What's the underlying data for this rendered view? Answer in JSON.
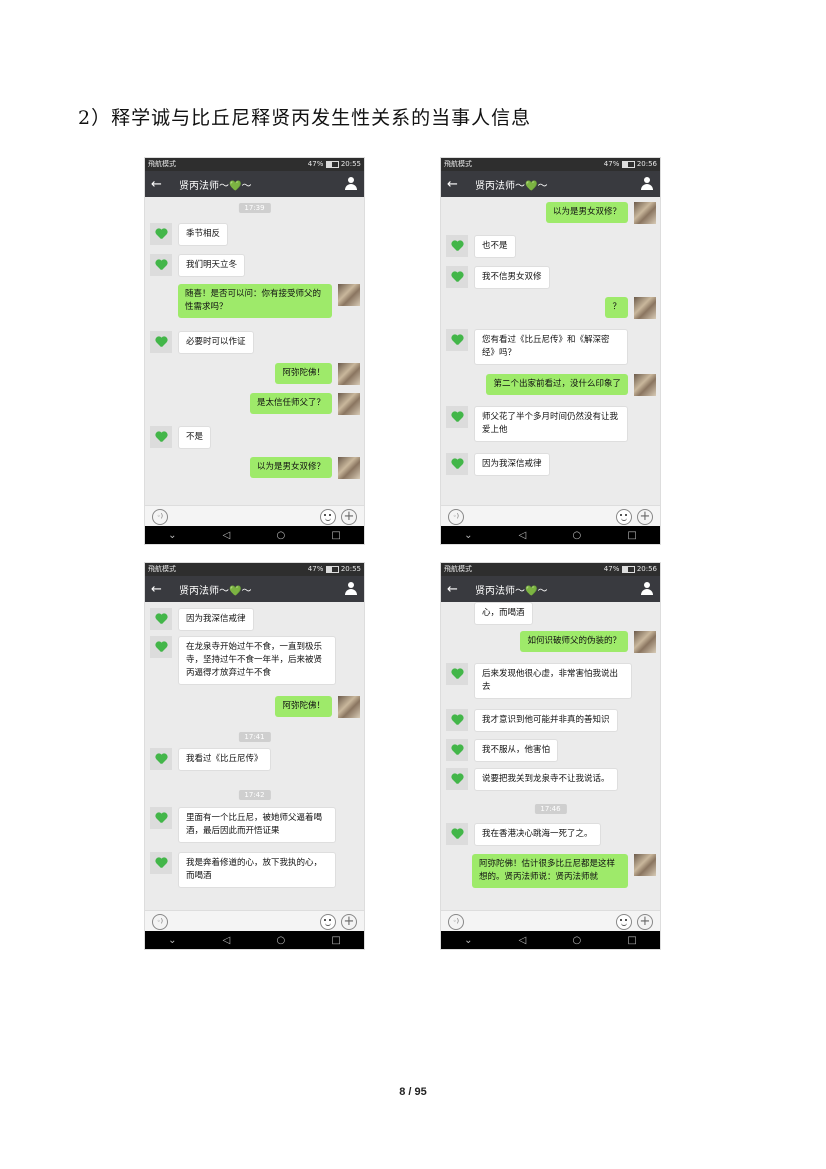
{
  "heading": "2）释学诚与比丘尼释贤丙发生性关系的当事人信息",
  "footer": "8 / 95",
  "status": {
    "left": "飛航模式",
    "right": "47%",
    "time1": "20:55",
    "time2": "20:56"
  },
  "chat_title": "贤丙法师～💚～",
  "screens": [
    {
      "time": "20:55",
      "messages": [
        {
          "dir": "time",
          "text": "17:39"
        },
        {
          "dir": "in",
          "text": "季节相反"
        },
        {
          "dir": "in",
          "text": "我们明天立冬"
        },
        {
          "dir": "out",
          "text": "随喜！是否可以问：你有接受师父的性需求吗？"
        },
        {
          "dir": "in",
          "text": "必要时可以作证"
        },
        {
          "dir": "out",
          "text": "阿弥陀佛！"
        },
        {
          "dir": "out",
          "text": "是太信任师父了？"
        },
        {
          "dir": "in",
          "text": "不是"
        },
        {
          "dir": "out",
          "text": "以为是男女双修？"
        }
      ]
    },
    {
      "time": "20:56",
      "messages": [
        {
          "dir": "out",
          "text": "以为是男女双修？"
        },
        {
          "dir": "in",
          "text": "也不是"
        },
        {
          "dir": "in",
          "text": "我不信男女双修"
        },
        {
          "dir": "out",
          "text": "？"
        },
        {
          "dir": "in",
          "text": "您有看过《比丘尼传》和《解深密经》吗？"
        },
        {
          "dir": "out",
          "text": "第二个出家前看过，没什么印象了"
        },
        {
          "dir": "in",
          "text": "师父花了半个多月时间仍然没有让我爱上他"
        },
        {
          "dir": "in",
          "text": "因为我深信戒律"
        }
      ]
    },
    {
      "time": "20:55",
      "messages": [
        {
          "dir": "in",
          "text": "因为我深信戒律"
        },
        {
          "dir": "in",
          "text": "在龙泉寺开始过午不食，一直到极乐寺，坚持过午不食一年半，后来被贤丙逼得才放弃过午不食"
        },
        {
          "dir": "out",
          "text": "阿弥陀佛！"
        },
        {
          "dir": "time",
          "text": "17:41"
        },
        {
          "dir": "in",
          "text": "我看过《比丘尼传》"
        },
        {
          "dir": "time",
          "text": "17:42"
        },
        {
          "dir": "in",
          "text": "里面有一个比丘尼，被她师父逼着喝酒，最后因此而开悟证果"
        },
        {
          "dir": "in",
          "text": "我是奔着修道的心，放下我执的心，而喝酒"
        }
      ]
    },
    {
      "time": "20:56",
      "messages": [
        {
          "dir": "in",
          "text": "心，而喝酒"
        },
        {
          "dir": "out",
          "text": "如何识破师父的伪装的？"
        },
        {
          "dir": "in",
          "text": "后来发现他很心虚，非常害怕我说出去"
        },
        {
          "dir": "in",
          "text": "我才意识到他可能并非真的善知识"
        },
        {
          "dir": "in",
          "text": "我不服从，他害怕"
        },
        {
          "dir": "in",
          "text": "说要把我关到龙泉寺不让我说话。"
        },
        {
          "dir": "time",
          "text": "17:46"
        },
        {
          "dir": "in",
          "text": "我在香港决心跳海一死了之。"
        },
        {
          "dir": "out",
          "text": "阿弥陀佛！估计很多比丘尼都是这样想的。贤丙法师说：贤丙法师就"
        }
      ]
    }
  ],
  "nav": {
    "down": "⌄",
    "back": "◁",
    "home": "○",
    "recent": "□"
  }
}
